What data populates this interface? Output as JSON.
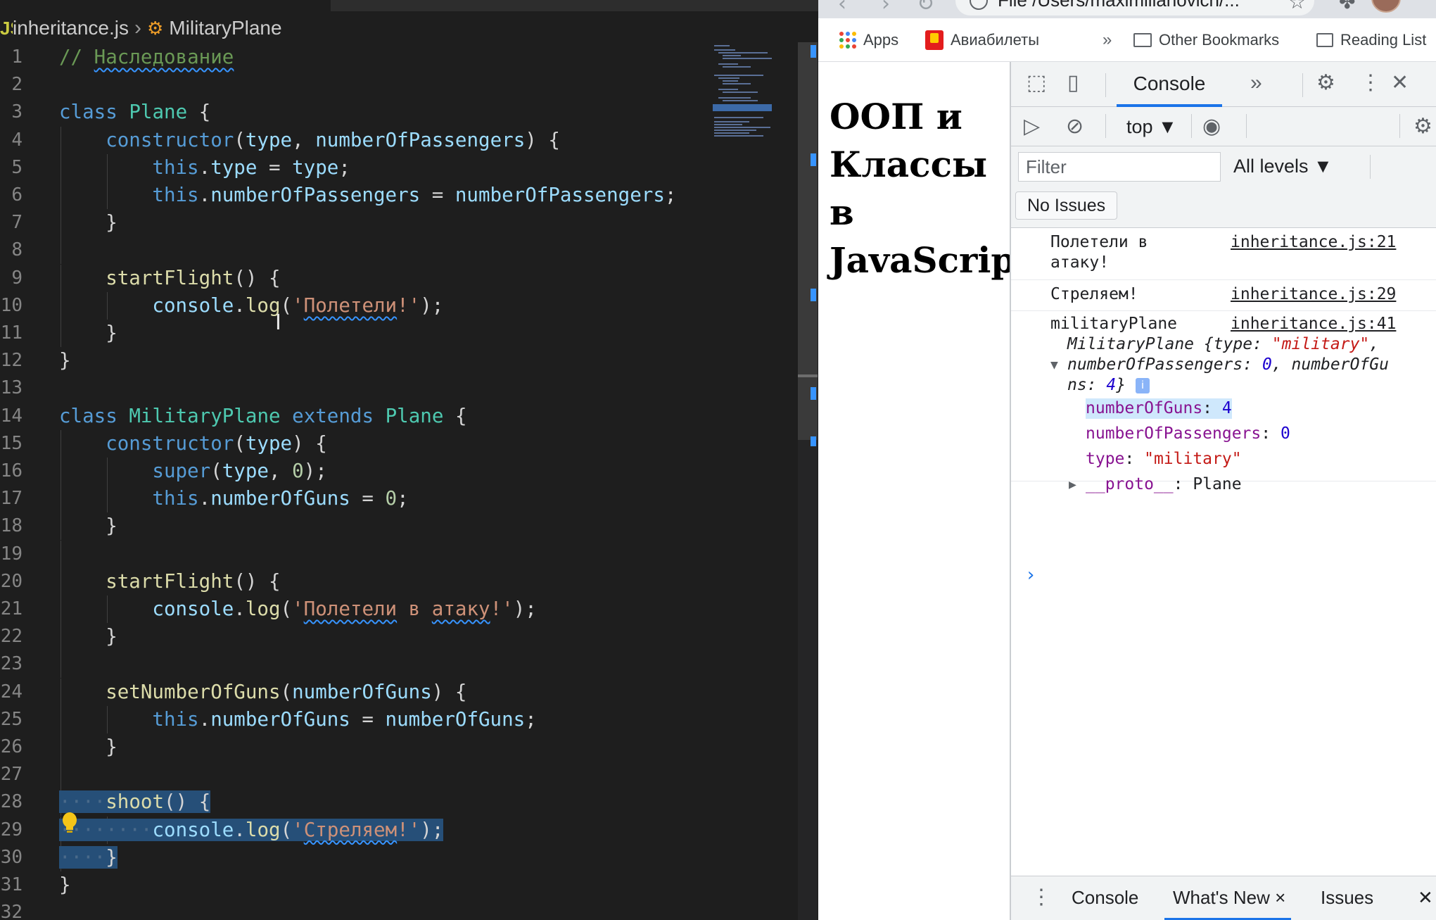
{
  "editor": {
    "breadcrumb": {
      "badge": "JS",
      "file": "inheritance.js",
      "symbol": "MilitaryPlane"
    },
    "lines": [
      {
        "n": "1",
        "indent": 0,
        "tokens": [
          [
            "cm sq",
            "// "
          ],
          [
            "cm squig",
            "Наследование"
          ]
        ]
      },
      {
        "n": "2",
        "indent": 0,
        "tokens": []
      },
      {
        "n": "3",
        "indent": 0,
        "tokens": [
          [
            "kw",
            "class "
          ],
          [
            "cl",
            "Plane"
          ],
          [
            "",
            " {"
          ]
        ]
      },
      {
        "n": "4",
        "indent": 1,
        "tokens": [
          [
            "kw",
            "constructor"
          ],
          [
            "",
            "("
          ],
          [
            "va",
            "type"
          ],
          [
            "",
            ", "
          ],
          [
            "va",
            "numberOfPassengers"
          ],
          [
            "",
            ") {"
          ]
        ]
      },
      {
        "n": "5",
        "indent": 2,
        "tokens": [
          [
            "kw",
            "this"
          ],
          [
            "",
            "."
          ],
          [
            "va",
            "type"
          ],
          [
            "",
            " = "
          ],
          [
            "va",
            "type"
          ],
          [
            "",
            ";"
          ]
        ]
      },
      {
        "n": "6",
        "indent": 2,
        "tokens": [
          [
            "kw",
            "this"
          ],
          [
            "",
            "."
          ],
          [
            "va",
            "numberOfPassengers"
          ],
          [
            "",
            " = "
          ],
          [
            "va",
            "numberOfPassengers"
          ],
          [
            "",
            ";"
          ]
        ]
      },
      {
        "n": "7",
        "indent": 1,
        "tokens": [
          [
            "",
            "}"
          ]
        ]
      },
      {
        "n": "8",
        "indent": 1,
        "tokens": []
      },
      {
        "n": "9",
        "indent": 1,
        "tokens": [
          [
            "fn",
            "startFlight"
          ],
          [
            "",
            "() {"
          ]
        ]
      },
      {
        "n": "10",
        "indent": 2,
        "tokens": [
          [
            "va",
            "console"
          ],
          [
            "",
            "."
          ],
          [
            "fn",
            "log"
          ],
          [
            "",
            "("
          ],
          [
            "st",
            "'"
          ],
          [
            "st squig",
            "Полетели"
          ],
          [
            "st",
            "!'"
          ],
          [
            "",
            ");"
          ]
        ]
      },
      {
        "n": "11",
        "indent": 1,
        "tokens": [
          [
            "",
            "}"
          ]
        ]
      },
      {
        "n": "12",
        "indent": 0,
        "tokens": [
          [
            "",
            "}"
          ]
        ]
      },
      {
        "n": "13",
        "indent": 0,
        "tokens": []
      },
      {
        "n": "14",
        "indent": 0,
        "tokens": [
          [
            "kw",
            "class "
          ],
          [
            "cl",
            "MilitaryPlane"
          ],
          [
            "kw",
            " extends "
          ],
          [
            "cl",
            "Plane"
          ],
          [
            "",
            " {"
          ]
        ]
      },
      {
        "n": "15",
        "indent": 1,
        "tokens": [
          [
            "kw",
            "constructor"
          ],
          [
            "",
            "("
          ],
          [
            "va",
            "type"
          ],
          [
            "",
            ") {"
          ]
        ]
      },
      {
        "n": "16",
        "indent": 2,
        "tokens": [
          [
            "kw",
            "super"
          ],
          [
            "",
            "("
          ],
          [
            "va",
            "type"
          ],
          [
            "",
            ", "
          ],
          [
            "nu",
            "0"
          ],
          [
            "",
            ");"
          ]
        ]
      },
      {
        "n": "17",
        "indent": 2,
        "tokens": [
          [
            "kw",
            "this"
          ],
          [
            "",
            "."
          ],
          [
            "va",
            "numberOfGuns"
          ],
          [
            "",
            " = "
          ],
          [
            "nu",
            "0"
          ],
          [
            "",
            ";"
          ]
        ]
      },
      {
        "n": "18",
        "indent": 1,
        "tokens": [
          [
            "",
            "}"
          ]
        ]
      },
      {
        "n": "19",
        "indent": 1,
        "tokens": []
      },
      {
        "n": "20",
        "indent": 1,
        "tokens": [
          [
            "fn",
            "startFlight"
          ],
          [
            "",
            "() {"
          ]
        ]
      },
      {
        "n": "21",
        "indent": 2,
        "tokens": [
          [
            "va",
            "console"
          ],
          [
            "",
            "."
          ],
          [
            "fn",
            "log"
          ],
          [
            "",
            "("
          ],
          [
            "st",
            "'"
          ],
          [
            "st squig",
            "Полетели"
          ],
          [
            "st",
            " в "
          ],
          [
            "st squig",
            "атаку"
          ],
          [
            "st",
            "!'"
          ],
          [
            "",
            ");"
          ]
        ]
      },
      {
        "n": "22",
        "indent": 1,
        "tokens": [
          [
            "",
            "}"
          ]
        ]
      },
      {
        "n": "23",
        "indent": 1,
        "tokens": []
      },
      {
        "n": "24",
        "indent": 1,
        "tokens": [
          [
            "fn",
            "setNumberOfGuns"
          ],
          [
            "",
            "("
          ],
          [
            "va",
            "numberOfGuns"
          ],
          [
            "",
            ") {"
          ]
        ]
      },
      {
        "n": "25",
        "indent": 2,
        "tokens": [
          [
            "kw",
            "this"
          ],
          [
            "",
            "."
          ],
          [
            "va",
            "numberOfGuns"
          ],
          [
            "",
            " = "
          ],
          [
            "va",
            "numberOfGuns"
          ],
          [
            "",
            ";"
          ]
        ]
      },
      {
        "n": "26",
        "indent": 1,
        "tokens": [
          [
            "",
            "}"
          ]
        ]
      },
      {
        "n": "27",
        "indent": 1,
        "tokens": []
      },
      {
        "n": "28",
        "indent": 1,
        "selected": true,
        "tokens": [
          [
            "fn",
            "shoot"
          ],
          [
            "",
            "() {"
          ]
        ]
      },
      {
        "n": "29",
        "indent": 2,
        "selected": true,
        "tokens": [
          [
            "va",
            "console"
          ],
          [
            "",
            "."
          ],
          [
            "fn",
            "log"
          ],
          [
            "",
            "("
          ],
          [
            "st",
            "'"
          ],
          [
            "st squig",
            "Стреляем"
          ],
          [
            "st",
            "!'"
          ],
          [
            "",
            ");"
          ]
        ]
      },
      {
        "n": "30",
        "indent": 1,
        "selected": true,
        "tokens": [
          [
            "",
            "}"
          ]
        ]
      },
      {
        "n": "31",
        "indent": 0,
        "tokens": [
          [
            "",
            "}"
          ]
        ]
      },
      {
        "n": "32",
        "indent": 0,
        "tokens": []
      }
    ]
  },
  "browser": {
    "url": "File  /Users/maximilianovich/...",
    "bookmarks": {
      "apps": "Apps",
      "avia": "Авиабилеты",
      "more": "»",
      "other": "Other Bookmarks",
      "reading": "Reading List"
    },
    "page_heading": "ООП и\nКлассы\nв\nJavaScript"
  },
  "devtools": {
    "tab_console": "Console",
    "context": "top ▼",
    "filter_placeholder": "Filter",
    "levels": "All levels ▼",
    "issues_button": "No Issues",
    "messages": [
      {
        "text": "Полетели в\nатаку!",
        "source": "inheritance.js:21"
      },
      {
        "text": "Стреляем!",
        "source": "inheritance.js:29"
      },
      {
        "text": "militaryPlane",
        "source": "inheritance.js:41"
      }
    ],
    "object_preview": {
      "class_name": "MilitaryPlane",
      "preview_line1": " {type: ",
      "preview_type": "\"military\"",
      "preview_comma": ",",
      "preview_line2_a": "numberOfPassengers: ",
      "preview_passengers": "0",
      "preview_line2_b": ", numberOfGu",
      "preview_line3_a": "ns: ",
      "preview_guns": "4",
      "preview_line3_b": "}",
      "info_badge": "i",
      "props": [
        {
          "key": "numberOfGuns",
          "value": "4",
          "kind": "num",
          "selected": true
        },
        {
          "key": "numberOfPassengers",
          "value": "0",
          "kind": "num"
        },
        {
          "key": "type",
          "value": "\"military\"",
          "kind": "str"
        }
      ],
      "proto_key": "__proto__",
      "proto_value": ": Plane"
    },
    "prompt": "›",
    "drawer_tabs": {
      "console": "Console",
      "whats_new": "What's New",
      "issues": "Issues",
      "close": "×"
    }
  }
}
